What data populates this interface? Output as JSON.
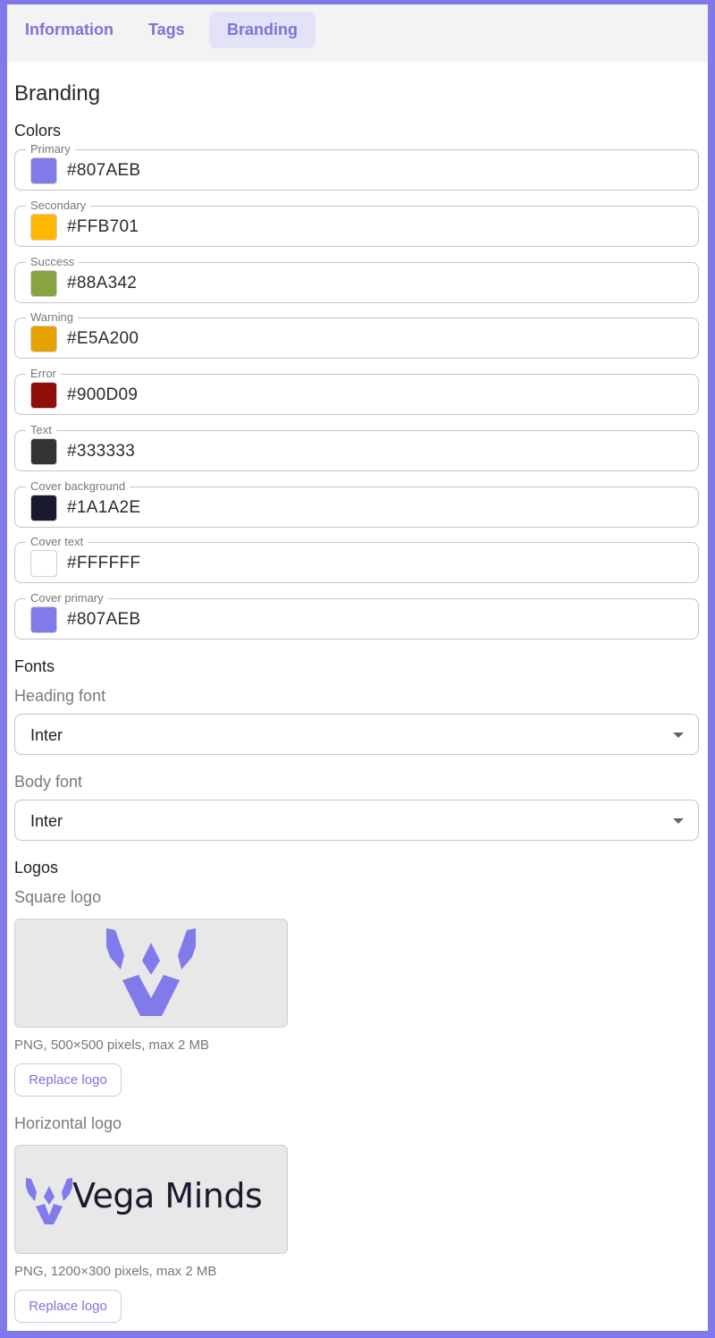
{
  "tabs": [
    {
      "label": "Information",
      "active": false
    },
    {
      "label": "Tags",
      "active": false
    },
    {
      "label": "Branding",
      "active": true
    }
  ],
  "page_title": "Branding",
  "colors_heading": "Colors",
  "colors": [
    {
      "label": "Primary",
      "value": "#807AEB"
    },
    {
      "label": "Secondary",
      "value": "#FFB701"
    },
    {
      "label": "Success",
      "value": "#88A342"
    },
    {
      "label": "Warning",
      "value": "#E5A200"
    },
    {
      "label": "Error",
      "value": "#900D09"
    },
    {
      "label": "Text",
      "value": "#333333"
    },
    {
      "label": "Cover background",
      "value": "#1A1A2E"
    },
    {
      "label": "Cover text",
      "value": "#FFFFFF"
    },
    {
      "label": "Cover primary",
      "value": "#807AEB"
    }
  ],
  "fonts_heading": "Fonts",
  "heading_font": {
    "label": "Heading font",
    "value": "Inter"
  },
  "body_font": {
    "label": "Body font",
    "value": "Inter"
  },
  "logos_heading": "Logos",
  "square_logo": {
    "label": "Square logo",
    "hint": "PNG, 500×500 pixels, max 2 MB",
    "button": "Replace logo"
  },
  "horizontal_logo": {
    "label": "Horizontal logo",
    "brand_text": "Vega Minds",
    "hint": "PNG, 1200×300 pixels, max 2 MB",
    "button": "Replace logo"
  },
  "accent_color": "#807AEB"
}
